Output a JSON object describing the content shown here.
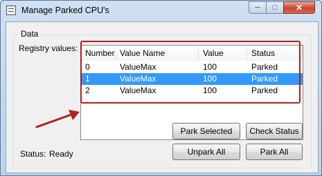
{
  "window": {
    "title": "Manage Parked CPU's",
    "minimize_glyph": "─",
    "maximize_glyph": "□",
    "close_glyph": "✕"
  },
  "group": {
    "legend": "Data"
  },
  "registry_label": "Registry values:",
  "table": {
    "columns": [
      "Number",
      "Value Name",
      "Value",
      "Status"
    ],
    "rows": [
      {
        "number": "0",
        "value_name": "ValueMax",
        "value": "100",
        "status": "Parked",
        "selected": false
      },
      {
        "number": "1",
        "value_name": "ValueMax",
        "value": "100",
        "status": "Parked",
        "selected": true
      },
      {
        "number": "2",
        "value_name": "ValueMax",
        "value": "100",
        "status": "Parked",
        "selected": false
      }
    ]
  },
  "buttons": {
    "park_selected": "Park Selected",
    "check_status": "Check Status",
    "unpark_all": "Unpark All",
    "park_all": "Park All"
  },
  "status": {
    "label": "Status:",
    "value": "Ready"
  },
  "colors": {
    "selection": "#3399ff",
    "annotation": "#b21e1e"
  }
}
